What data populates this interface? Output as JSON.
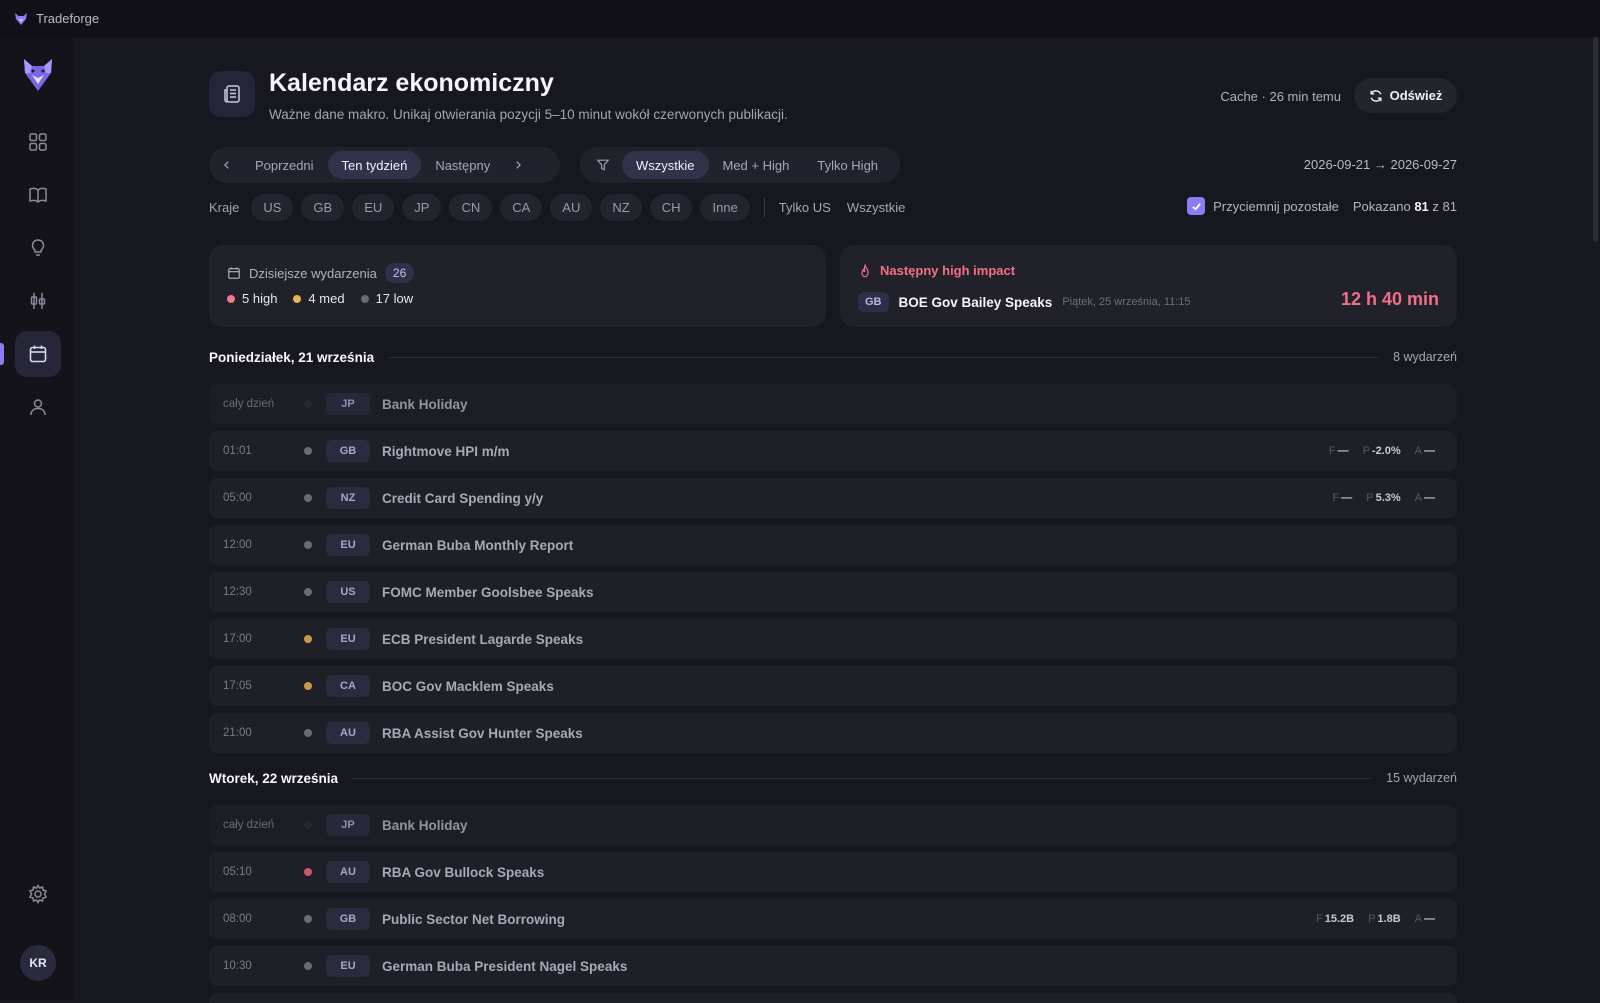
{
  "app": {
    "title": "Tradeforge"
  },
  "header": {
    "title": "Kalendarz ekonomiczny",
    "subtitle": "Ważne dane makro. Unikaj otwierania pozycji 5–10 minut wokół czerwonych publikacji.",
    "cache_status": "Cache · 26 min temu",
    "refresh_label": "Odśwież"
  },
  "sidebar": {
    "items": [
      "dashboard-icon",
      "journal-icon",
      "ideas-icon",
      "strategy-icon",
      "calendar-icon",
      "profile-icon"
    ],
    "active": "calendar",
    "avatar_initials": "KR"
  },
  "period_nav": {
    "prev": "Poprzedni",
    "current": "Ten tydzień",
    "next": "Następny"
  },
  "impact_filter": {
    "all": "Wszystkie",
    "med_high": "Med + High",
    "high_only": "Tylko High",
    "selected": "Wszystkie"
  },
  "date_range": "2026-09-21 → 2026-09-27",
  "countries": {
    "label": "Kraje",
    "chips": [
      "US",
      "GB",
      "EU",
      "JP",
      "CN",
      "CA",
      "AU",
      "NZ",
      "CH",
      "Inne"
    ],
    "only_us": "Tylko US",
    "all": "Wszystkie"
  },
  "dim_others": {
    "label": "Przyciemnij pozostałe",
    "checked": true
  },
  "shown": {
    "prefix": "Pokazano",
    "count": "81",
    "sep": "z",
    "total": "81"
  },
  "today": {
    "title": "Dzisiejsze wydarzenia",
    "count": "26",
    "high": "5 high",
    "med": "4 med",
    "low": "17 low"
  },
  "next_high": {
    "title": "Następny high impact",
    "country": "GB",
    "event": "BOE Gov Bailey Speaks",
    "date": "Piątek, 25 września, 11:15",
    "countdown": "12 h 40 min"
  },
  "colors": {
    "high": "#f07a8c",
    "med": "#e8b257",
    "low": "#6a6a78",
    "holiday": "#2a2a34",
    "accent": "#8b7cf6"
  },
  "days": [
    {
      "name": "Poniedziałek, 21 września",
      "count": "8 wydarzeń",
      "events": [
        {
          "time": "cały dzień",
          "impact": "holiday",
          "country": "JP",
          "name": "Bank Holiday"
        },
        {
          "time": "01:01",
          "impact": "low",
          "country": "GB",
          "name": "Rightmove HPI m/m",
          "f": "—",
          "p": "-2.0%",
          "a": "—"
        },
        {
          "time": "05:00",
          "impact": "low",
          "country": "NZ",
          "name": "Credit Card Spending y/y",
          "f": "—",
          "p": "5.3%",
          "a": "—"
        },
        {
          "time": "12:00",
          "impact": "low",
          "country": "EU",
          "name": "German Buba Monthly Report"
        },
        {
          "time": "12:30",
          "impact": "low",
          "country": "US",
          "name": "FOMC Member Goolsbee Speaks"
        },
        {
          "time": "17:00",
          "impact": "med",
          "country": "EU",
          "name": "ECB President Lagarde Speaks"
        },
        {
          "time": "17:05",
          "impact": "med",
          "country": "CA",
          "name": "BOC Gov Macklem Speaks"
        },
        {
          "time": "21:00",
          "impact": "low",
          "country": "AU",
          "name": "RBA Assist Gov Hunter Speaks"
        }
      ]
    },
    {
      "name": "Wtorek, 22 września",
      "count": "15 wydarzeń",
      "events": [
        {
          "time": "cały dzień",
          "impact": "holiday",
          "country": "JP",
          "name": "Bank Holiday"
        },
        {
          "time": "05:10",
          "impact": "high",
          "country": "AU",
          "name": "RBA Gov Bullock Speaks"
        },
        {
          "time": "08:00",
          "impact": "low",
          "country": "GB",
          "name": "Public Sector Net Borrowing",
          "f": "15.2B",
          "p": "1.8B",
          "a": "—"
        },
        {
          "time": "10:30",
          "impact": "low",
          "country": "EU",
          "name": "German Buba President Nagel Speaks"
        }
      ]
    }
  ],
  "value_labels": {
    "f": "F",
    "p": "P",
    "a": "A"
  }
}
